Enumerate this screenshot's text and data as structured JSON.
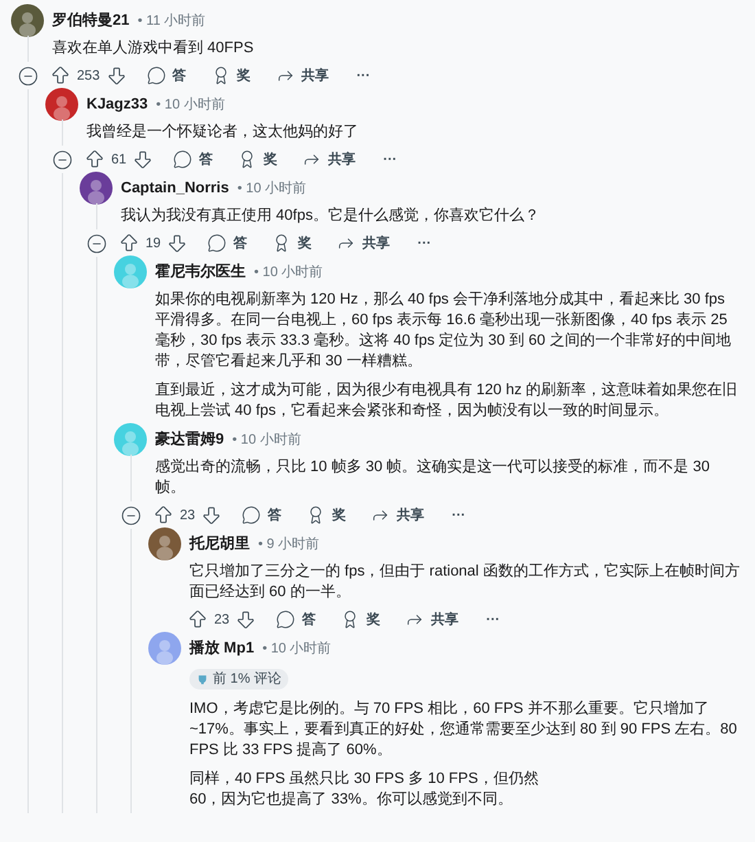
{
  "comments": [
    {
      "author": "罗伯特曼21",
      "time": "• 11 小时前",
      "color": "#5a5a3c",
      "body": [
        [
          "喜欢在单人游戏中看到 40FPS"
        ]
      ],
      "actions": {
        "votes": "253",
        "reply": "答",
        "award": "奖",
        "share": "共享",
        "more": "···"
      },
      "children": [
        {
          "author": "KJagz33",
          "time": "• 10 小时前",
          "color": "#c62828",
          "body": [
            [
              "我曾经是一个怀疑论者，这太他妈的好了"
            ]
          ],
          "actions": {
            "votes": "61",
            "reply": "答",
            "award": "奖",
            "share": "共享",
            "more": "···"
          },
          "children": [
            {
              "author": "Captain_Norris",
              "time": "• 10 小时前",
              "color": "#6a3d9a",
              "body": [
                [
                  "我认为我没有真正使用 40fps。它是什么感觉，你喜欢它什么？"
                ]
              ],
              "actions": {
                "votes": "19",
                "reply": "答",
                "award": "奖",
                "share": "共享",
                "more": "···"
              },
              "children": [
                {
                  "author": "霍尼韦尔医生",
                  "time": "• 10 小时前",
                  "color": "#46d2e0",
                  "body": [
                    [
                      "如果你的电视刷新率为 120 Hz，那么 40 fps 会干净利落地分成其中，看起来比 30 fps 平滑得多。在同一台电视上，60 fps 表示每 16.6 毫秒出现一张新图像，40 fps 表示 25 毫秒，30 fps 表示 33.3 毫秒。这将 40 fps 定位为 30 到 60 之间的一个非常好的中间地带，尽管它看起来几乎和 30 一样糟糕。"
                    ],
                    [
                      "直到最近，这才成为可能，因为很少有电视具有 120 hz 的刷新率，这意味着如果您在旧电视上尝试 40 fps，它看起来会紧张和奇怪，因为帧没有以一致的时间显示。"
                    ]
                  ]
                },
                {
                  "author": "豪达雷姆9",
                  "time": "• 10 小时前",
                  "color": "#46d2e0",
                  "body": [
                    [
                      "感觉出奇的流畅，只比 10 帧多 30 帧。这确实是这一代可以接受的标准，而不是 30 帧。"
                    ]
                  ],
                  "actions": {
                    "votes": "23",
                    "reply": "答",
                    "award": "奖",
                    "share": "共享",
                    "more": "···"
                  },
                  "children": [
                    {
                      "author": "托尼胡里",
                      "time": "• 9 小时前",
                      "color": "#7a5a3a",
                      "body": [
                        [
                          "它只增加了三分之一的 fps，但由于 rational 函数的工作方式，它实际上在帧时间方面已经达到 60 的一半。"
                        ]
                      ],
                      "actions": {
                        "votes": "23",
                        "reply": "答",
                        "award": "奖",
                        "share": "共享",
                        "more": "···"
                      }
                    },
                    {
                      "author": "播放 Mp1",
                      "time": "• 10 小时前",
                      "color": "#8ea6ee",
                      "flair": "前 1% 评论",
                      "body": [
                        [
                          "IMO，考虑它是比例的。与 70 FPS 相比，60 FPS 并不那么重要。它只增加了 ~17%。事实上，要看到真正的好处，您通常需要至少达到 80 到 90 FPS 左右。80 FPS 比 33 FPS 提高了 60%。"
                        ],
                        [
                          "同样，40 FPS 虽然只比 30 FPS 多 10 FPS，但仍然",
                          "60，因为它也提高了 33%。你可以感觉到不同。"
                        ]
                      ]
                    }
                  ]
                }
              ]
            }
          ]
        }
      ]
    }
  ]
}
